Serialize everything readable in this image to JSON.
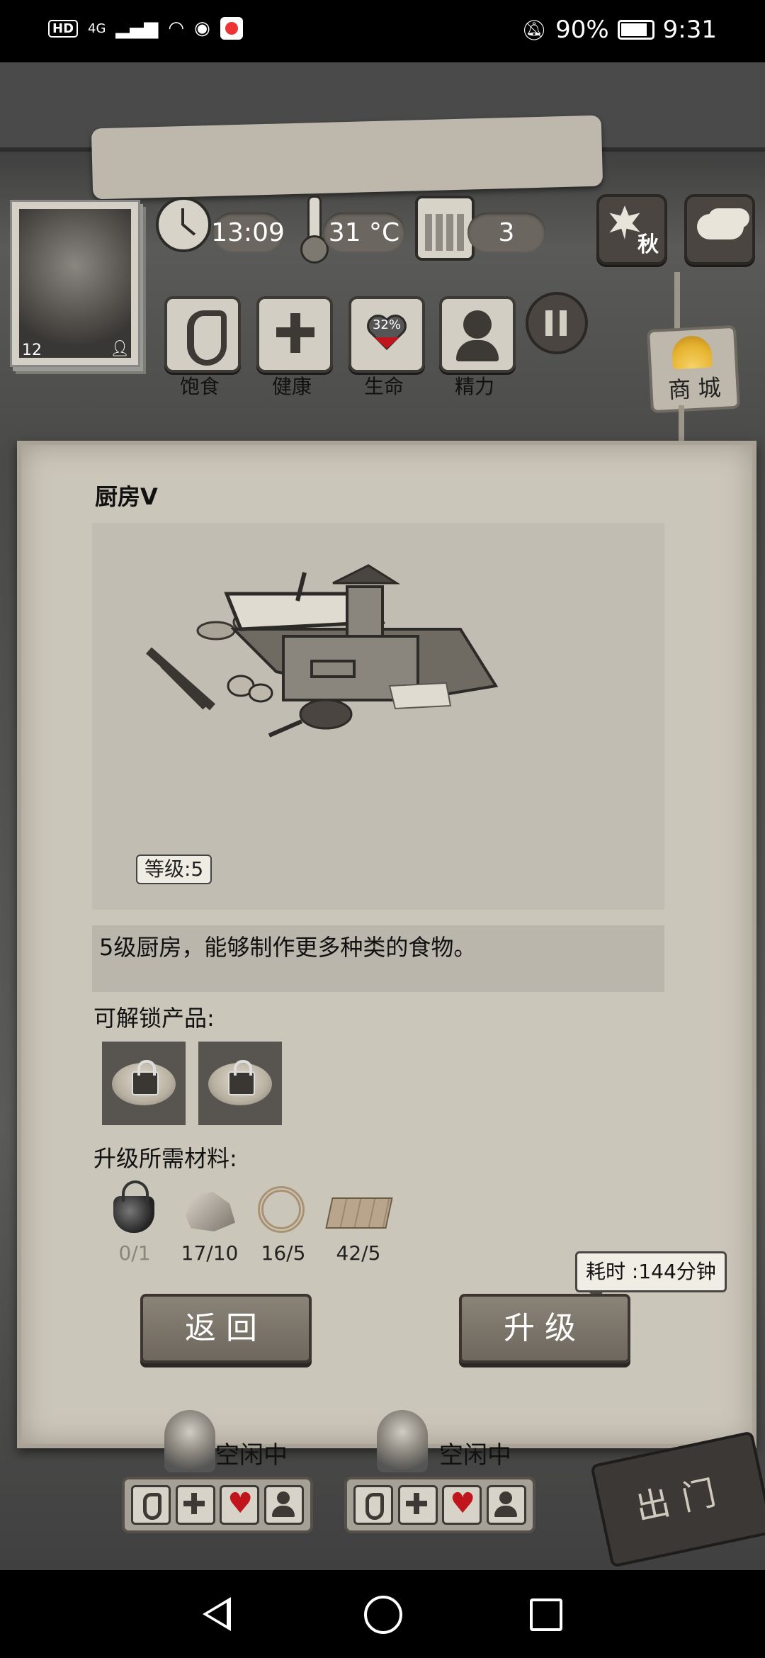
{
  "status_bar": {
    "network": "HD",
    "signal": "4G",
    "battery": "90%",
    "time": "9:31"
  },
  "hud": {
    "clock": "13:09",
    "temperature": "31 °C",
    "day": "3",
    "season": "秋",
    "player_level": "12",
    "stats": [
      {
        "label": "饱食",
        "icon": "stomach-icon"
      },
      {
        "label": "健康",
        "icon": "cross-icon"
      },
      {
        "label": "生命",
        "icon": "heart-icon",
        "value": "32%"
      },
      {
        "label": "精力",
        "icon": "person-icon"
      }
    ],
    "shop_label": "商 城"
  },
  "panel": {
    "title": "厨房V",
    "level_tag": "等级:5",
    "description": "5级厨房，能够制作更多种类的食物。",
    "unlock_label": "可解锁产品:",
    "materials_label": "升级所需材料:",
    "materials": [
      {
        "icon": "pot-icon",
        "count": "0/1"
      },
      {
        "icon": "stone-icon",
        "count": "17/10"
      },
      {
        "icon": "rope-icon",
        "count": "16/5"
      },
      {
        "icon": "plank-icon",
        "count": "42/5"
      }
    ],
    "time_cost": "耗时 :144分钟",
    "back_label": "返回",
    "upgrade_label": "升级"
  },
  "survivors": [
    {
      "status": "空闲中"
    },
    {
      "status": "空闲中"
    }
  ],
  "exit_label": "出门",
  "colors": {
    "parchment": "#cbc6ba",
    "wood_button": "#7d766b",
    "heart_red": "#c0151d",
    "shell_gold": "#e6b32f"
  }
}
